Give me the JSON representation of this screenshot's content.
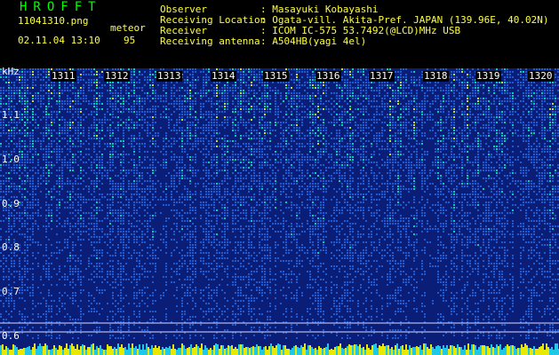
{
  "header": {
    "brand": "HROFFT",
    "filename": "11041310.png",
    "datetime": "02.11.04 13:10",
    "meteor_label": "meteor",
    "meteor_count": "95",
    "info": [
      {
        "label": "Observer",
        "value": ": Masayuki Kobayashi"
      },
      {
        "label": "Receiving Location",
        "value": ": Ogata-vill. Akita-Pref. JAPAN (139.96E, 40.02N)"
      },
      {
        "label": "Receiver",
        "value": ": ICOM IC-575 53.7492(@LCD)MHz USB"
      },
      {
        "label": "Receiving antenna",
        "value": ": A504HB(yagi 4el)"
      }
    ]
  },
  "spectrogram": {
    "unit": "kHz",
    "freq_ticks": [
      "1.1",
      "1.0",
      "0.9",
      "0.8",
      "0.7",
      "0.6"
    ],
    "minute_labels": [
      "1311",
      "1312",
      "1313",
      "1314",
      "1315",
      "1316",
      "1317",
      "1318",
      "1319",
      "1320"
    ],
    "colors": {
      "background": "#000000",
      "text_primary": "#ffff3c",
      "brand": "#00ff00",
      "deep": "#0a1e78",
      "mid": "#1e5ad2",
      "hot": "#00d2b4",
      "peak": "#c8dc32"
    }
  }
}
